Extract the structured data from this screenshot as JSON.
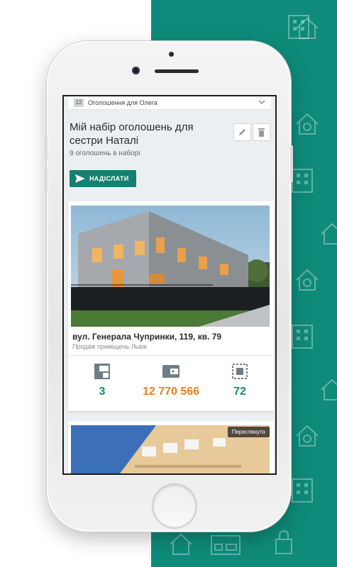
{
  "colors": {
    "brand_teal": "#0e8b7a",
    "button_green": "#14806f",
    "price_orange": "#ef7d1a",
    "stat_teal": "#178a78"
  },
  "topbar": {
    "badge": "12",
    "title": "Оголошення для Олега",
    "icon": "chevron-down-icon"
  },
  "set": {
    "title": "Мій набір оголошень для сестри Наталі",
    "subtitle": "9 оголошень в наборі",
    "edit_icon": "pencil-icon",
    "delete_icon": "trash-icon"
  },
  "send_button": {
    "label": "НАДІСЛАТИ",
    "icon": "send-icon"
  },
  "listing": {
    "address": "вул. Генерала Чупринки, 119, кв. 79",
    "category": "Продаж приміщень Львів",
    "stats": [
      {
        "icon": "floor-plan-icon",
        "value": "3"
      },
      {
        "icon": "wallet-icon",
        "value": "12 770 566"
      },
      {
        "icon": "area-icon",
        "value": "72"
      }
    ]
  },
  "listing2": {
    "badge": "Переглянуто"
  }
}
